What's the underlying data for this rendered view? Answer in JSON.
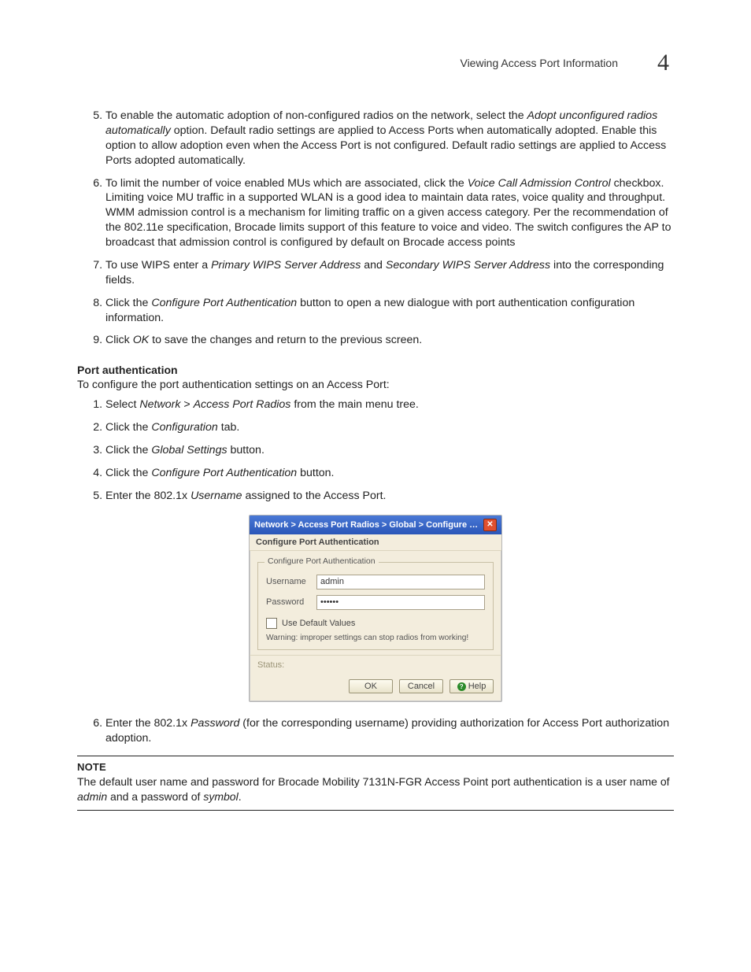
{
  "header": {
    "section_title": "Viewing Access Port Information",
    "chapter_number": "4"
  },
  "stepsA": {
    "start": 5,
    "items": [
      {
        "pre": "To enable the automatic adoption of non-configured radios on the network, select the ",
        "em1": "Adopt unconfigured radios automatically",
        "post": " option. Default radio settings are applied to Access Ports when automatically adopted. Enable this option to allow adoption even when the Access Port is not configured. Default radio settings are applied to Access Ports adopted automatically."
      },
      {
        "pre": "To limit the number of voice enabled MUs which are associated, click the ",
        "em1": "Voice Call Admission Control",
        "post": " checkbox. Limiting voice MU traffic in a supported WLAN is a good idea to maintain data rates, voice quality and throughput. WMM admission control is a mechanism for limiting traffic on a given access category. Per the recommendation of the 802.11e specification, Brocade limits support of this feature to voice and video. The switch configures the AP to broadcast that admission control is configured by default on Brocade access points"
      },
      {
        "pre": "To use WIPS enter a ",
        "em1": "Primary WIPS Server Address",
        "mid": " and ",
        "em2": "Secondary WIPS Server Address",
        "post": " into the corresponding fields."
      },
      {
        "pre": "Click the ",
        "em1": "Configure Port Authentication",
        "post": " button to open a new dialogue with port authentication configuration information."
      },
      {
        "pre": "Click ",
        "em1": "OK",
        "post": " to save the changes and return to the previous screen."
      }
    ]
  },
  "portAuth": {
    "heading": "Port authentication",
    "lead": "To configure the port authentication settings on an Access Port:",
    "steps": [
      {
        "pre": "Select ",
        "em1": "Network",
        "mid": " > ",
        "em2": "Access Port Radios",
        "post": " from the main menu tree."
      },
      {
        "pre": "Click the ",
        "em1": "Configuration",
        "post": " tab."
      },
      {
        "pre": "Click the ",
        "em1": "Global Settings",
        "post": " button."
      },
      {
        "pre": "Click the ",
        "em1": "Configure Port Authentication",
        "post": " button."
      },
      {
        "pre": "Enter the 802.1x ",
        "em1": "Username",
        "post": " assigned to the Access Port."
      }
    ],
    "step6": {
      "pre": "Enter the 802.1x ",
      "em1": "Password",
      "post": " (for the corresponding username) providing authorization for Access Port authorization adoption."
    }
  },
  "dialog": {
    "title": "Network > Access Port Radios > Global > Configure …",
    "subtitle": "Configure Port Authentication",
    "legend": "Configure Port Authentication",
    "fields": {
      "username_label": "Username",
      "username_value": "admin",
      "password_label": "Password",
      "password_value": "••••••"
    },
    "checkbox_label": "Use Default Values",
    "warning": "Warning: improper settings can stop radios from working!",
    "status_label": "Status:",
    "buttons": {
      "ok": "OK",
      "cancel": "Cancel",
      "help": "Help"
    }
  },
  "note": {
    "label": "NOTE",
    "pre": "The default user name and password for Brocade Mobility 7131N-FGR Access Point port authentication is a user name of ",
    "em1": "admin",
    "mid": " and a password of ",
    "em2": "symbol",
    "post": "."
  }
}
